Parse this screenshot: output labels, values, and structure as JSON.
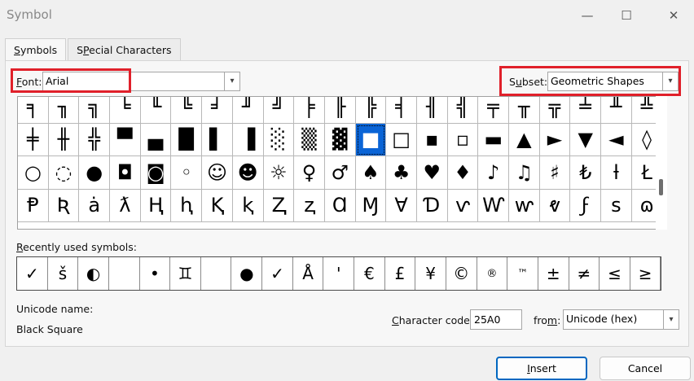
{
  "window": {
    "title": "Symbol",
    "minimize_glyph": "—",
    "maximize_glyph": "☐",
    "close_glyph": "✕"
  },
  "tabs": [
    {
      "label": "Symbols",
      "accel": "S",
      "rest": "ymbols"
    },
    {
      "label": "Special Characters",
      "accel": "P",
      "pre": "S",
      "rest": "ecial Characters"
    }
  ],
  "font": {
    "label_accel": "F",
    "label_rest": "ont:",
    "value": "Arial"
  },
  "subset": {
    "label_accel": "u",
    "label_pre": "S",
    "label_rest": "bset:",
    "value": "Geometric Shapes"
  },
  "symbol_grid": {
    "rows": [
      [
        "╕",
        "╖",
        "╗",
        "╘",
        "╙",
        "╚",
        "╛",
        "╜",
        "╝",
        "╞",
        "╟",
        "╠",
        "╡",
        "╢",
        "╣",
        "╤",
        "╥",
        "╦",
        "╧",
        "╨",
        "╩"
      ],
      [
        "╪",
        "╫",
        "╬",
        "▀",
        "▄",
        "█",
        "▌",
        "▐",
        "░",
        "▒",
        "▓",
        "■",
        "□",
        "▪",
        "▫",
        "▬",
        "▲",
        "►",
        "▼",
        "◄",
        "◊"
      ],
      [
        "○",
        "◌",
        "●",
        "◘",
        "◙",
        "◦",
        "☺",
        "☻",
        "☼",
        "♀",
        "♂",
        "♠",
        "♣",
        "♥",
        "♦",
        "♪",
        "♫",
        "♯",
        "₺",
        "ƚ",
        "Ł"
      ],
      [
        "Ᵽ",
        "Ʀ",
        "ȧ",
        "ƛ",
        "Ⱨ",
        "ⱨ",
        "Ⱪ",
        "ⱪ",
        "Ⱬ",
        "ⱬ",
        "Ɑ",
        "Ɱ",
        "Ɐ",
        "Ɗ",
        "ⱱ",
        "Ⱳ",
        "ⱳ",
        "ⱴ",
        "ϝ",
        "ꜱ",
        "ɷ"
      ]
    ],
    "selected": {
      "row": 1,
      "col": 11
    }
  },
  "recent": {
    "label_accel": "R",
    "label_rest": "ecently used symbols:",
    "symbols": [
      "✓",
      "š",
      "◐",
      "",
      "•",
      "♊",
      "",
      "●",
      "✓",
      "Å",
      "'",
      "€",
      "£",
      "¥",
      "©",
      "®",
      "™",
      "±",
      "≠",
      "≤",
      "≥"
    ]
  },
  "unicode_name": {
    "label": "Unicode name:",
    "value": "Black Square"
  },
  "character_code": {
    "label_accel": "C",
    "label_rest": "haracter code:",
    "value": "25A0"
  },
  "from": {
    "label_pre": "fro",
    "label_accel": "m",
    "label_rest": ":",
    "value": "Unicode (hex)"
  },
  "buttons": {
    "insert_accel": "I",
    "insert_rest": "nsert",
    "cancel": "Cancel"
  }
}
